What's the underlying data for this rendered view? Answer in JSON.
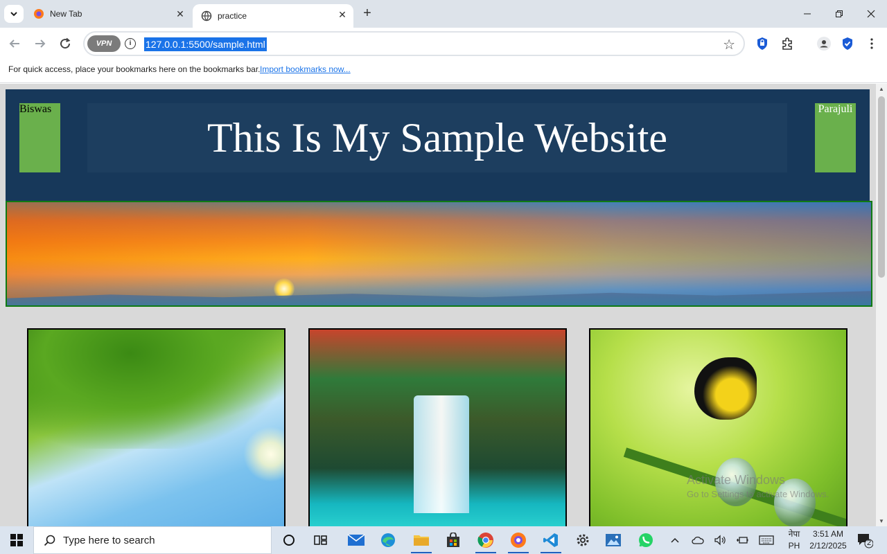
{
  "browser": {
    "tabs": [
      {
        "title": "New Tab",
        "favicon": "brave-icon",
        "active": false
      },
      {
        "title": "practice",
        "favicon": "globe-icon",
        "active": true
      }
    ],
    "url": "127.0.0.1:5500/sample.html",
    "vpn_label": "VPN",
    "bookmarks_message": "For quick access, place your bookmarks here on the bookmarks bar.",
    "bookmarks_link": "Import bookmarks now..."
  },
  "page": {
    "left_label": "Biswas",
    "right_label": "Parajuli",
    "title": "This Is My Sample Website",
    "colors": {
      "header_bg": "#17385a",
      "title_bg": "#1d3e5f",
      "side_box": "#6ab04c",
      "banner_border": "#0f7a12",
      "page_bg": "#d9d9d9"
    }
  },
  "watermark": {
    "title": "Activate Windows",
    "subtitle": "Go to Settings to activate Windows."
  },
  "taskbar": {
    "search_placeholder": "Type here to search",
    "time": "3:51 AM",
    "date": "2/12/2025",
    "lang_top": "नेपा",
    "lang_bottom": "PH",
    "notification_count": "2"
  }
}
